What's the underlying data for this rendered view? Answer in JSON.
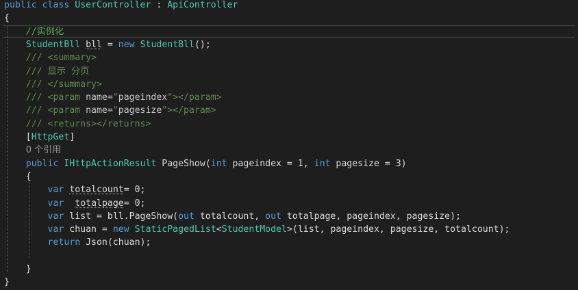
{
  "lines": [
    {
      "id": "l1",
      "tokens": [
        [
          "kw",
          "public"
        ],
        [
          "plain",
          " "
        ],
        [
          "kw",
          "class"
        ],
        [
          "plain",
          " "
        ],
        [
          "type",
          "UserController"
        ],
        [
          "plain",
          " : "
        ],
        [
          "type",
          "ApiController"
        ]
      ]
    },
    {
      "id": "l2",
      "tokens": [
        [
          "plain",
          "{"
        ]
      ]
    },
    {
      "id": "l3",
      "tokens": [
        [
          "plain",
          "    "
        ],
        [
          "cm",
          "//实例化"
        ]
      ]
    },
    {
      "id": "l4",
      "tokens": [
        [
          "plain",
          "    "
        ],
        [
          "type",
          "StudentBll"
        ],
        [
          "plain",
          " "
        ],
        [
          "squig",
          "bll"
        ],
        [
          "plain",
          " = "
        ],
        [
          "kw",
          "new"
        ],
        [
          "plain",
          " "
        ],
        [
          "type",
          "StudentBll"
        ],
        [
          "plain",
          "();"
        ]
      ]
    },
    {
      "id": "l5",
      "tokens": [
        [
          "plain",
          "    "
        ],
        [
          "doc",
          "/// "
        ],
        [
          "xmltag",
          "<summary>"
        ]
      ]
    },
    {
      "id": "l6",
      "tokens": [
        [
          "plain",
          "    "
        ],
        [
          "doc",
          "/// 显示 分页"
        ]
      ]
    },
    {
      "id": "l7",
      "tokens": [
        [
          "plain",
          "    "
        ],
        [
          "doc",
          "/// "
        ],
        [
          "xmltag",
          "</summary>"
        ]
      ]
    },
    {
      "id": "l8",
      "tokens": [
        [
          "plain",
          "    "
        ],
        [
          "doc",
          "/// "
        ],
        [
          "xmltag",
          "<param "
        ],
        [
          "attrname",
          "name="
        ],
        [
          "xmltag",
          "\""
        ],
        [
          "str",
          "pageindex"
        ],
        [
          "xmltag",
          "\"></param>"
        ]
      ]
    },
    {
      "id": "l9",
      "tokens": [
        [
          "plain",
          "    "
        ],
        [
          "doc",
          "/// "
        ],
        [
          "xmltag",
          "<param "
        ],
        [
          "attrname",
          "name="
        ],
        [
          "xmltag",
          "\""
        ],
        [
          "str",
          "pagesize"
        ],
        [
          "xmltag",
          "\"></param>"
        ]
      ]
    },
    {
      "id": "l10",
      "tokens": [
        [
          "plain",
          "    "
        ],
        [
          "doc",
          "/// "
        ],
        [
          "xmltag",
          "<returns></returns>"
        ]
      ]
    },
    {
      "id": "l11",
      "tokens": [
        [
          "plain",
          "    ["
        ],
        [
          "attr-name",
          "HttpGet"
        ],
        [
          "plain",
          "]"
        ]
      ]
    },
    {
      "id": "l12",
      "tokens": [
        [
          "plain",
          "    "
        ],
        [
          "lens",
          "0 个引用"
        ]
      ]
    },
    {
      "id": "l13",
      "tokens": [
        [
          "plain",
          "    "
        ],
        [
          "kw",
          "public"
        ],
        [
          "plain",
          " "
        ],
        [
          "type",
          "IHttpActionResult"
        ],
        [
          "plain",
          " "
        ],
        [
          "plain",
          "PageShow("
        ],
        [
          "kw",
          "int"
        ],
        [
          "plain",
          " pageindex = 1, "
        ],
        [
          "kw",
          "int"
        ],
        [
          "plain",
          " pagesize = 3)"
        ]
      ]
    },
    {
      "id": "l14",
      "tokens": [
        [
          "plain",
          "    {"
        ]
      ]
    },
    {
      "id": "l15",
      "tokens": [
        [
          "plain",
          "        "
        ],
        [
          "kw",
          "var"
        ],
        [
          "plain",
          " "
        ],
        [
          "squig",
          "totalcount"
        ],
        [
          "plain",
          "= 0;"
        ]
      ]
    },
    {
      "id": "l16",
      "tokens": [
        [
          "plain",
          "        "
        ],
        [
          "kw",
          "var"
        ],
        [
          "plain",
          "  "
        ],
        [
          "squig",
          "totalpage"
        ],
        [
          "plain",
          "= 0;"
        ]
      ]
    },
    {
      "id": "l17",
      "tokens": [
        [
          "plain",
          "        "
        ],
        [
          "kw",
          "var"
        ],
        [
          "plain",
          " list = bll.PageShow("
        ],
        [
          "kw",
          "out"
        ],
        [
          "plain",
          " totalcount, "
        ],
        [
          "kw",
          "out"
        ],
        [
          "plain",
          " totalpage, pageindex, pagesize);"
        ]
      ]
    },
    {
      "id": "l18",
      "tokens": [
        [
          "plain",
          "        "
        ],
        [
          "kw",
          "var"
        ],
        [
          "plain",
          " chuan = "
        ],
        [
          "kw",
          "new"
        ],
        [
          "plain",
          " "
        ],
        [
          "type",
          "StaticPagedList"
        ],
        [
          "plain",
          "<"
        ],
        [
          "type",
          "StudentModel"
        ],
        [
          "plain",
          ">(list, pageindex, pagesize, totalcount);"
        ]
      ]
    },
    {
      "id": "l19",
      "tokens": [
        [
          "plain",
          "        "
        ],
        [
          "kw",
          "return"
        ],
        [
          "plain",
          " Json(chuan);"
        ]
      ]
    },
    {
      "id": "l20",
      "tokens": [
        [
          "plain",
          ""
        ]
      ]
    },
    {
      "id": "l21",
      "tokens": [
        [
          "plain",
          "    }"
        ]
      ]
    },
    {
      "id": "l22",
      "tokens": [
        [
          "plain",
          "}"
        ]
      ]
    }
  ]
}
